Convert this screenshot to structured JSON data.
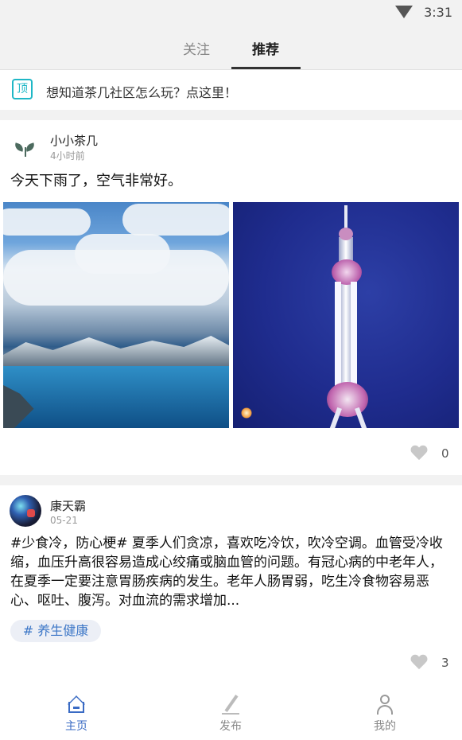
{
  "status_bar": {
    "time": "3:31"
  },
  "tabs": [
    {
      "label": "关注",
      "active": false
    },
    {
      "label": "推荐",
      "active": true
    }
  ],
  "notice": {
    "icon_text": "顶",
    "text": "想知道茶几社区怎么玩？点这里！"
  },
  "posts": [
    {
      "username": "小小茶几",
      "time": "4小时前",
      "text": "今天下雨了，空气非常好。",
      "images": [
        "lake-landscape-photo",
        "oriental-pearl-tower-photo"
      ],
      "likes": "0"
    },
    {
      "username": "康天霸",
      "time": "05-21",
      "text": "#少食冷，防心梗# 夏季人们贪凉，喜欢吃冷饮，吹冷空调。血管受冷收缩，血压升高很容易造成心绞痛或脑血管的问题。有冠心病的中老年人，在夏季一定要注意胃肠疾病的发生。老年人肠胃弱，吃生冷食物容易恶心、呕吐、腹泻。对血流的需求增加...",
      "tag": "# 养生健康",
      "likes": "3"
    }
  ],
  "bottom_nav": [
    {
      "label": "主页",
      "icon": "home-icon",
      "active": true
    },
    {
      "label": "发布",
      "icon": "pen-icon",
      "active": false
    },
    {
      "label": "我的",
      "icon": "user-icon",
      "active": false
    }
  ],
  "colors": {
    "accent": "#3a6bc4",
    "pin": "#1fb7c6",
    "tag_text": "#3d77c7"
  }
}
